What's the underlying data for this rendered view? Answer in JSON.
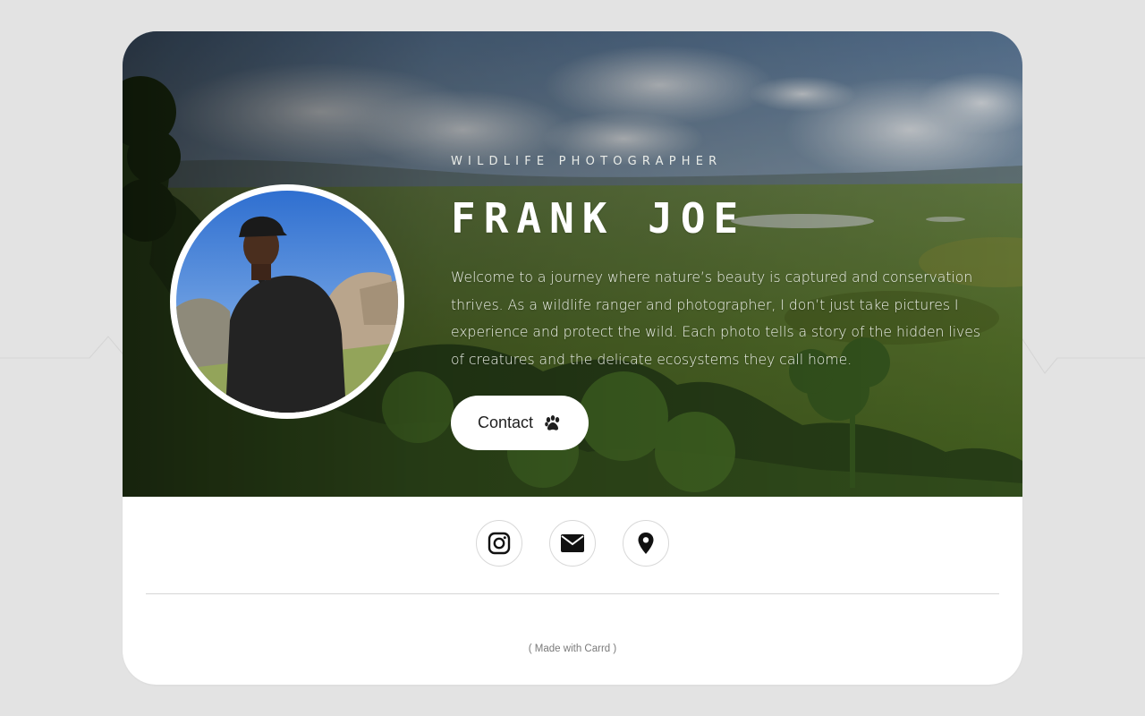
{
  "profile": {
    "subtitle": "WILDLIFE PHOTOGRAPHER",
    "name": "FRANK JOE",
    "bio": "Welcome to a journey where nature’s beauty is captured and conservation thrives. As a wildlife ranger and photographer, I don’t just take pictures I experience and protect the wild. Each photo tells a story of the hidden lives of creatures and the delicate ecosystems they call home."
  },
  "contact_button": {
    "label": "Contact",
    "icon": "paw-icon"
  },
  "social_links": [
    {
      "name": "instagram",
      "icon": "instagram-icon"
    },
    {
      "name": "email",
      "icon": "envelope-icon"
    },
    {
      "name": "location",
      "icon": "map-pin-icon"
    }
  ],
  "footer": {
    "made_with": "( Made with Carrd )"
  },
  "colors": {
    "page_background": "#e3e3e3",
    "card_background": "#ffffff",
    "text_light": "#ffffff",
    "button_text": "#1f1f1f"
  }
}
